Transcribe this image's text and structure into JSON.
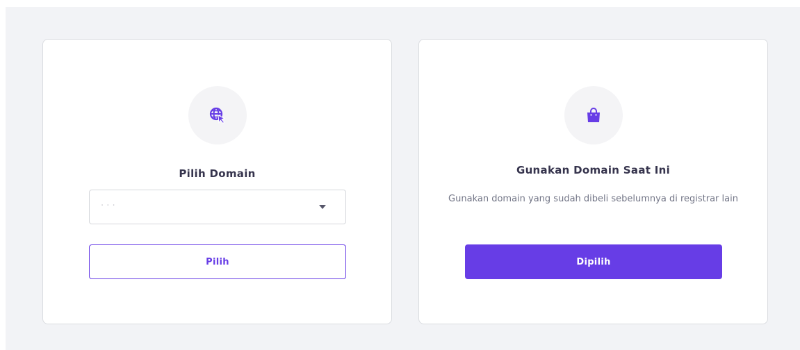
{
  "cards": [
    {
      "icon": "globe-cursor-icon",
      "title": "Pilih Domain",
      "select": {
        "value": "· ·  ·"
      },
      "button_label": "Pilih"
    },
    {
      "icon": "shopping-bag-icon",
      "title": "Gunakan Domain Saat Ini",
      "description": "Gunakan domain yang sudah dibeli sebelumnya di registrar lain",
      "button_label": "Dipilih"
    }
  ],
  "colors": {
    "accent": "#673de6",
    "background": "#f2f3f6",
    "card": "#ffffff",
    "icon_circle": "#f4f4f6"
  }
}
